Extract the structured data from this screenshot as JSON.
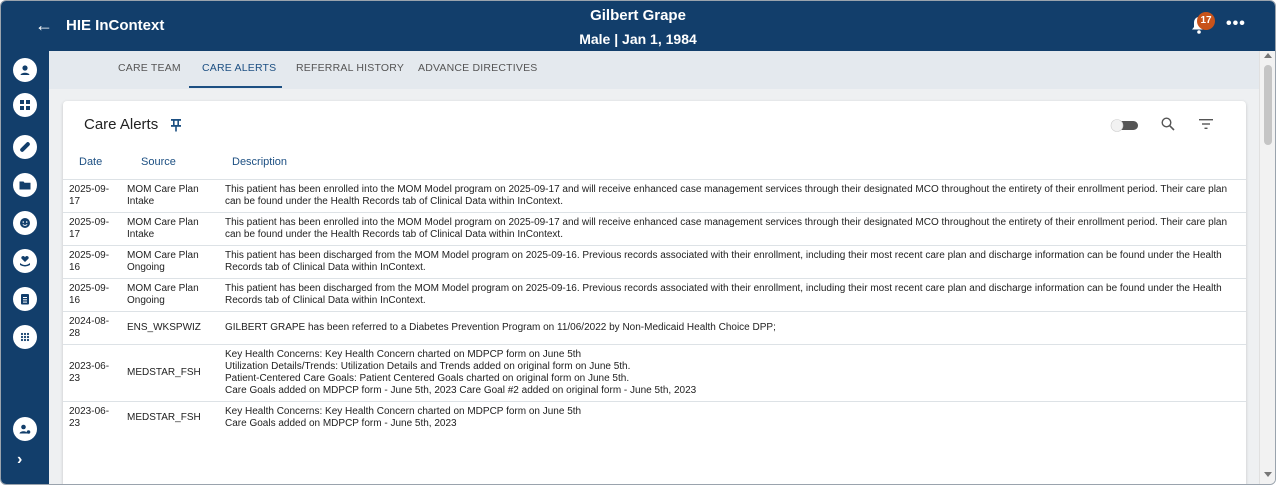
{
  "header": {
    "app_title": "HIE InContext",
    "patient_name": "Gilbert Grape",
    "patient_info": "Male | Jan 1, 1984",
    "notification_count": "17",
    "back_icon": "arrow-left-icon",
    "more_icon": "ellipsis-icon"
  },
  "tabs": [
    {
      "label": "CARE TEAM",
      "active": false
    },
    {
      "label": "CARE ALERTS",
      "active": true
    },
    {
      "label": "REFERRAL HISTORY",
      "active": false
    },
    {
      "label": "ADVANCE DIRECTIVES",
      "active": false
    }
  ],
  "card": {
    "title": "Care Alerts",
    "columns": [
      "Date",
      "Source",
      "Description"
    ]
  },
  "rows": [
    {
      "date": "2025-09-\n17",
      "source": "MOM Care Plan\nIntake",
      "description": [
        "This patient has been enrolled into the MOM Model program on 2025-09-17 and will receive enhanced case management services through their designated MCO throughout the entirety of their enrollment period.  Their care plan can be found under the Health Records tab of Clinical Data within InContext."
      ]
    },
    {
      "date": "2025-09-\n17",
      "source": "MOM Care Plan\nIntake",
      "description": [
        "This patient has been enrolled into the MOM Model program on 2025-09-17 and will receive enhanced case management services through their designated MCO throughout the entirety of their enrollment period.  Their care plan can be found under the Health Records tab of Clinical Data within InContext."
      ]
    },
    {
      "date": "2025-09-\n16",
      "source": "MOM Care Plan\nOngoing",
      "description": [
        "This patient has been discharged from the MOM Model program on 2025-09-16. Previous records associated with their enrollment, including their most recent care plan and discharge information can be found under the Health Records tab of Clinical Data within InContext."
      ]
    },
    {
      "date": "2025-09-\n16",
      "source": "MOM Care Plan\nOngoing",
      "description": [
        "This patient has been discharged from the MOM Model program on 2025-09-16. Previous records associated with their enrollment, including their most recent care plan and discharge information can be found under the Health Records tab of Clinical Data within InContext."
      ]
    },
    {
      "date": "2024-08-\n28",
      "source": "ENS_WKSPWIZ",
      "description": [
        "GILBERT GRAPE has been referred to a Diabetes Prevention Program on 11/06/2022 by Non-Medicaid Health Choice DPP;"
      ]
    },
    {
      "date": "2023-06-\n23",
      "source": "MEDSTAR_FSH",
      "description": [
        "Key Health Concerns: Key Health Concern charted on MDPCP form on June 5th",
        "Utilization Details/Trends: Utilization Details and Trends added on original form on June 5th.",
        "Patient-Centered Care Goals: Patient Centered Goals charted on original form on June 5th.",
        "Care Goals added on MDPCP form - June 5th, 2023 Care Goal #2 added on original form - June 5th, 2023"
      ]
    },
    {
      "date": "2023-06-\n23",
      "source": "MEDSTAR_FSH",
      "description": [
        "Key Health Concerns: Key Health Concern charted on MDPCP form on June 5th",
        "Care Goals added on MDPCP form - June 5th, 2023"
      ]
    }
  ],
  "colors": {
    "header_bg": "#123e6b",
    "accent": "#1c4f82",
    "badge": "#c8531b"
  },
  "sidebar_icons": [
    "user-icon",
    "dashboard-icon",
    "medication-icon",
    "folder-icon",
    "face-icon",
    "heart-hand-icon",
    "clipboard-icon",
    "apps-grid-icon",
    "user-settings-icon"
  ]
}
